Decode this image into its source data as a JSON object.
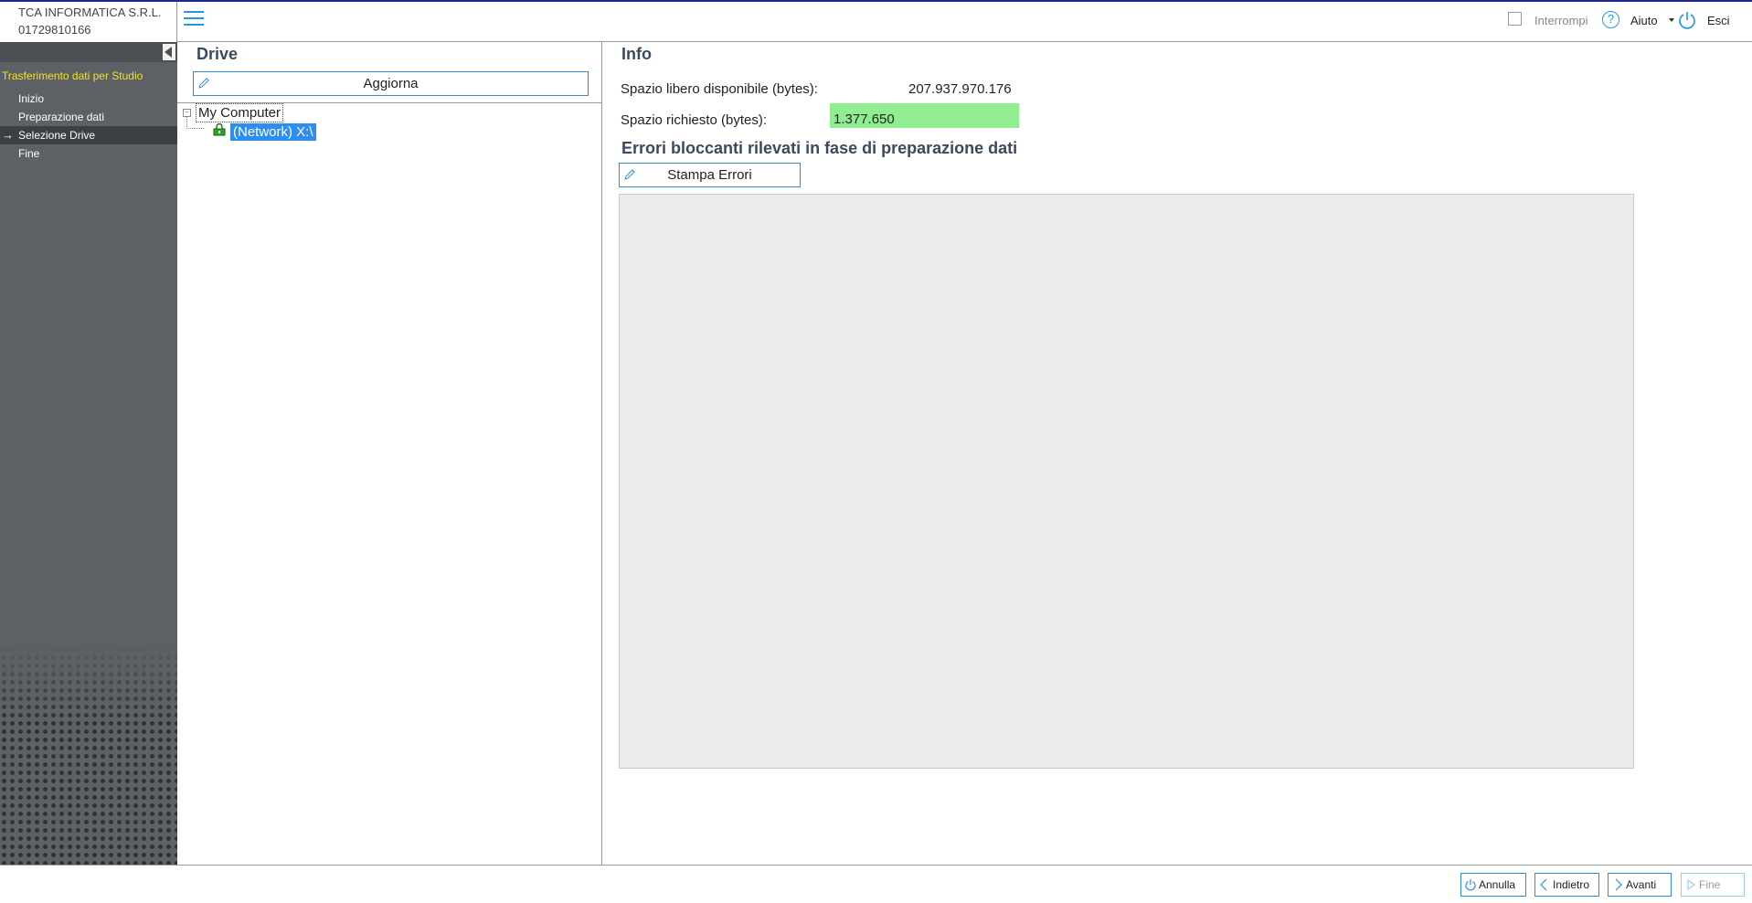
{
  "company": {
    "name": "TCA INFORMATICA S.R.L.",
    "code": "01729810166"
  },
  "wizard": {
    "title": "Trasferimento dati per Studio",
    "steps": [
      "Inizio",
      "Preparazione dati",
      "Selezione Drive",
      "Fine"
    ],
    "active_step": "Selezione Drive"
  },
  "header": {
    "interrompi_label": "Interrompi",
    "interrompi_checked": false,
    "help_label": "Aiuto",
    "exit_label": "Esci",
    "icons": [
      "menu-icon",
      "help-icon",
      "power-icon"
    ]
  },
  "drive": {
    "title": "Drive",
    "refresh_label": "Aggiorna",
    "tree": {
      "root": "My Computer",
      "children": [
        "(Network) X:\\"
      ],
      "selected": "(Network) X:\\"
    }
  },
  "info": {
    "title": "Info",
    "free_space_label": "Spazio libero disponibile (bytes):",
    "free_space_value": "207.937.970.176",
    "required_space_label": "Spazio richiesto (bytes):",
    "required_space_value": "1.377.650",
    "errors_title": "Errori bloccanti rilevati in fase di preparazione dati",
    "print_errors_label": "Stampa Errori"
  },
  "footer": {
    "cancel_label": "Annulla",
    "back_label": "Indietro",
    "next_label": "Avanti",
    "finish_label": "Fine"
  },
  "colors": {
    "accent": "#1e9be0",
    "sidebar": "#5d6064",
    "wizard_title": "#f2e32a",
    "required_highlight": "#90ee90",
    "selection": "#2e8df0"
  }
}
